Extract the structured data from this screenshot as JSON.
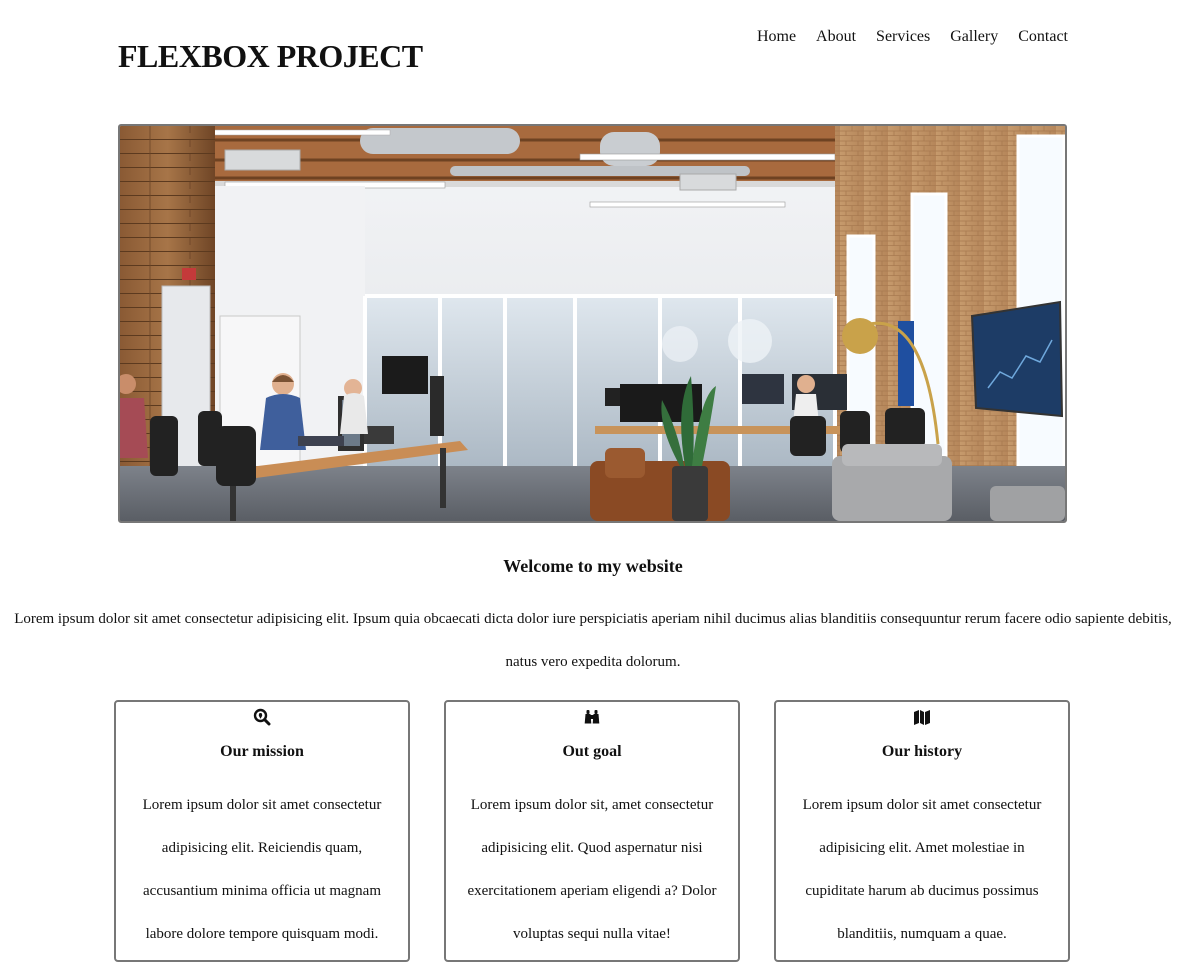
{
  "header": {
    "site_title": "FLEXBOX PROJECT",
    "nav": [
      "Home",
      "About",
      "Services",
      "Gallery",
      "Contact"
    ]
  },
  "hero": {
    "image_description": "open-plan office with people working at desks"
  },
  "welcome": {
    "title": "Welcome to my website",
    "text": "Lorem ipsum dolor sit amet consectetur adipisicing elit. Ipsum quia obcaecati dicta dolor iure perspiciatis aperiam nihil ducimus alias blanditiis consequuntur rerum facere odio sapiente debitis, natus vero expedita dolorum."
  },
  "cards": [
    {
      "icon": "search-location-icon",
      "title": "Our mission",
      "text": "Lorem ipsum dolor sit amet consectetur adipisicing elit. Reiciendis quam, accusantium minima officia ut magnam labore dolore tempore quisquam modi."
    },
    {
      "icon": "binoculars-icon",
      "title": "Out goal",
      "text": "Lorem ipsum dolor sit, amet consectetur adipisicing elit. Quod aspernatur nisi exercitationem aperiam eligendi a? Dolor voluptas sequi nulla vitae!"
    },
    {
      "icon": "map-icon",
      "title": "Our history",
      "text": "Lorem ipsum dolor sit amet consectetur adipisicing elit. Amet molestiae in cupiditate harum ab ducimus possimus blanditiis, numquam a quae."
    }
  ],
  "colors": {
    "text": "#111111",
    "border": "#777777",
    "background": "#ffffff"
  }
}
